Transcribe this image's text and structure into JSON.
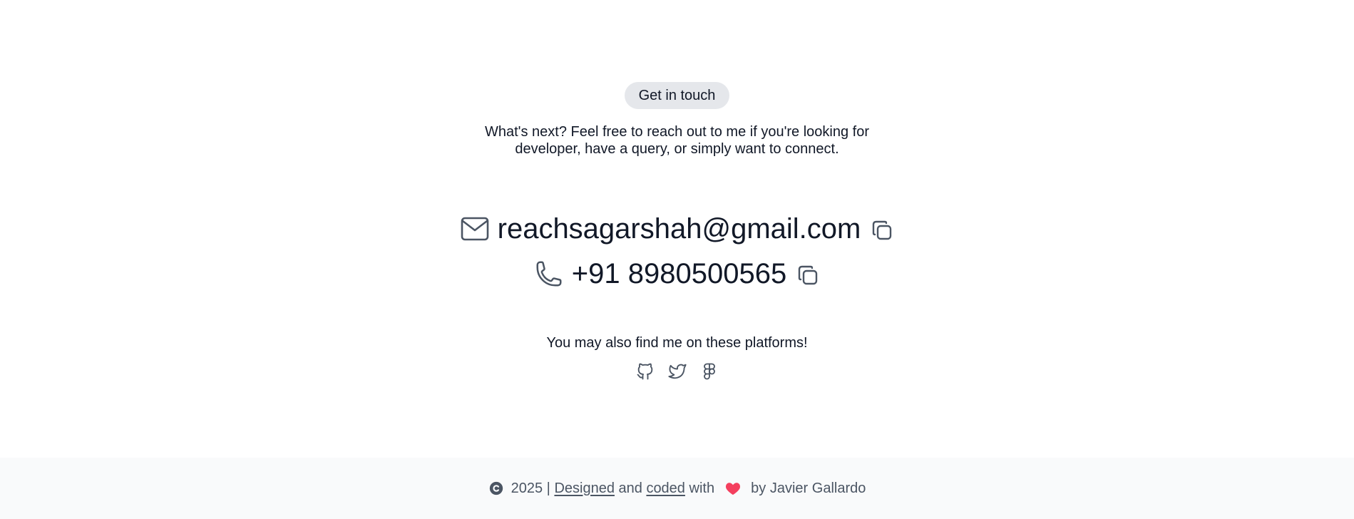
{
  "contact": {
    "badge": "Get in touch",
    "intro": "What's next? Feel free to reach out to me if you're looking for developer, have a query, or simply want to connect.",
    "email": "reachsagarshah@gmail.com",
    "phone": "+91 8980500565",
    "platforms_label": "You may also find me on these platforms!",
    "icons": {
      "email": "mail-icon",
      "phone": "phone-icon",
      "copy": "copy-icon"
    },
    "socials": [
      {
        "name": "github-icon"
      },
      {
        "name": "twitter-icon"
      },
      {
        "name": "figma-icon"
      }
    ]
  },
  "footer": {
    "year_text": "2025 | ",
    "designed": "Designed",
    "and": " and ",
    "coded": "coded",
    "with": " with ",
    "by": " by Javier Gallardo",
    "heart_color": "#f43f5e"
  }
}
